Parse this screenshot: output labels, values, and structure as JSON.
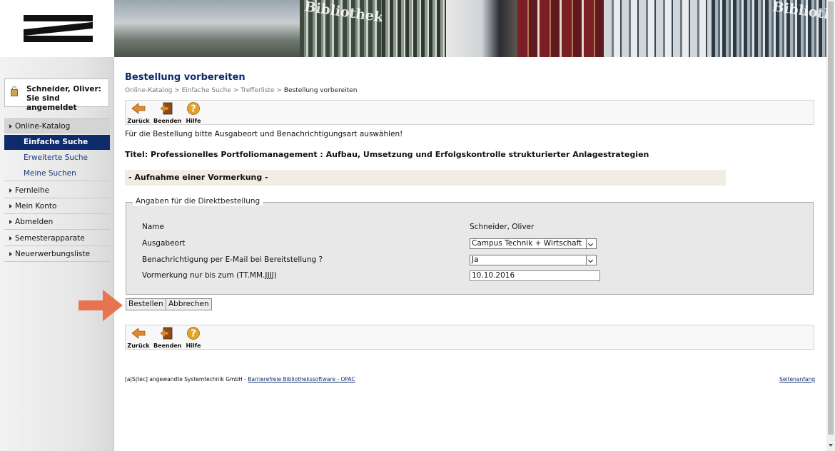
{
  "sidebar": {
    "login_status": "Schneider, Oliver: Sie sind angemeldet",
    "nav": [
      {
        "label": "Online-Katalog"
      },
      {
        "label": "Einfache Suche"
      },
      {
        "label": "Erweiterte Suche"
      },
      {
        "label": "Meine Suchen"
      },
      {
        "label": "Fernleihe"
      },
      {
        "label": "Mein Konto"
      },
      {
        "label": "Abmelden"
      },
      {
        "label": "Semesterapparate"
      },
      {
        "label": "Neuerwerbungsliste"
      }
    ]
  },
  "banner": {
    "label_1": "Bibliothek",
    "label_2": "Bibliothek"
  },
  "main": {
    "title": "Bestellung vorbereiten",
    "breadcrumb": [
      "Online-Katalog",
      "Einfache Suche",
      "Trefferliste",
      "Bestellung vorbereiten"
    ],
    "toolbar": {
      "back": "Zurück",
      "exit": "Beenden",
      "help": "Hilfe"
    },
    "intro": "Für die Bestellung bitte Ausgabeort und Benachrichtigungsart auswählen!",
    "item_title": "Titel: Professionelles Portfoliomanagement : Aufbau, Umsetzung und Erfolgskontrolle strukturierter Anlagestrategien",
    "section_header": "- Aufnahme einer Vormerkung -",
    "form": {
      "legend": "Angaben für die Direktbestellung",
      "name_label": "Name",
      "name_value": "Schneider, Oliver",
      "location_label": "Ausgabeort",
      "location_value": "Campus Technik + Wirtschaft",
      "notify_label": "Benachrichtigung per E-Mail bei Bereitstellung ?",
      "notify_value": "Ja",
      "until_label": "Vormerkung nur bis zum (TT.MM.JJJJ)",
      "until_value": "10.10.2016"
    },
    "order_button": "Bestellen",
    "cancel_button": "Abbrechen"
  },
  "footer": {
    "company": "[a|S|tec] angewandte Systemtechnik GmbH - ",
    "link": "Barrierefreie Bibliothekssoftware - OPAC",
    "top_link": "Seitenanfang"
  },
  "colors": {
    "accent": "#0f2b6b",
    "arrow": "#e8744f",
    "section_bg": "#f2ede3"
  }
}
